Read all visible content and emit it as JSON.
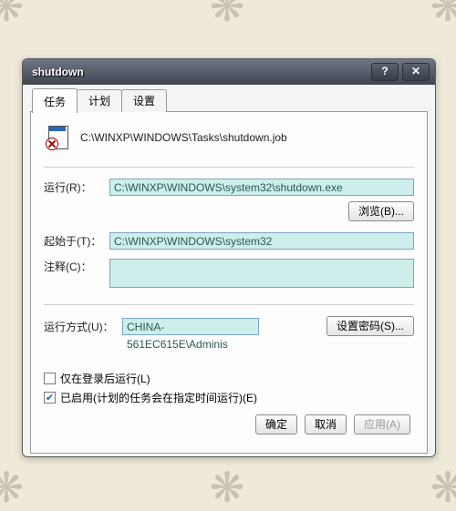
{
  "window": {
    "title": "shutdown"
  },
  "tabs": {
    "task": "任务",
    "schedule": "计划",
    "settings": "设置"
  },
  "file": {
    "path": "C:\\WINXP\\WINDOWS\\Tasks\\shutdown.job"
  },
  "labels": {
    "run": "运行(R)：",
    "start_in": "起始于(T)：",
    "comments": "注释(C)：",
    "run_as": "运行方式(U)："
  },
  "fields": {
    "run": "C:\\WINXP\\WINDOWS\\system32\\shutdown.exe",
    "start_in": "C:\\WINXP\\WINDOWS\\system32",
    "comments": "",
    "run_as": "CHINA-561EC615E\\Adminis"
  },
  "buttons": {
    "browse": "浏览(B)...",
    "set_password": "设置密码(S)...",
    "ok": "确定",
    "cancel": "取消",
    "apply": "应用(A)"
  },
  "checks": {
    "login_only": {
      "checked": false,
      "label": "仅在登录后运行(L)"
    },
    "enabled": {
      "checked": true,
      "label": "已启用(计划的任务会在指定时间运行)(E)"
    }
  },
  "titlebar_icons": {
    "help": "?",
    "close": "✕"
  }
}
